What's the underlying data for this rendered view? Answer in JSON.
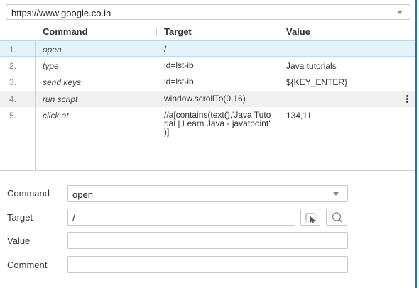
{
  "url": {
    "value": "https://www.google.co.in"
  },
  "table": {
    "headers": {
      "num": "",
      "command": "Command",
      "target": "Target",
      "value": "Value"
    },
    "rows": [
      {
        "num": "1.",
        "command": "open",
        "target": "/",
        "value": ""
      },
      {
        "num": "2.",
        "command": "type",
        "target": "id=lst-ib",
        "value": "Java tutorials"
      },
      {
        "num": "3.",
        "command": "send keys",
        "target": "id=lst-ib",
        "value": "${KEY_ENTER}"
      },
      {
        "num": "4.",
        "command": "run script",
        "target": "window.scrollTo(0,16)",
        "value": ""
      },
      {
        "num": "5.",
        "command": "click at",
        "target_lines": [
          "//a[contains(text(),'Java Tuto",
          "rial | Learn Java - javatpoint'",
          ")]"
        ],
        "value": "134,11"
      }
    ]
  },
  "form": {
    "command_label": "Command",
    "command_value": "open",
    "target_label": "Target",
    "target_value": "/",
    "value_label": "Value",
    "value_value": "",
    "comment_label": "Comment",
    "comment_value": ""
  },
  "icons": {
    "select_target": "select-target-icon",
    "find_target": "magnifier-icon",
    "more": "kebab-menu-icon"
  },
  "colors": {
    "selected_row": "#e3f2fb",
    "hover_row": "#f0f0f0",
    "panel_edge": "#2e6bbf"
  }
}
